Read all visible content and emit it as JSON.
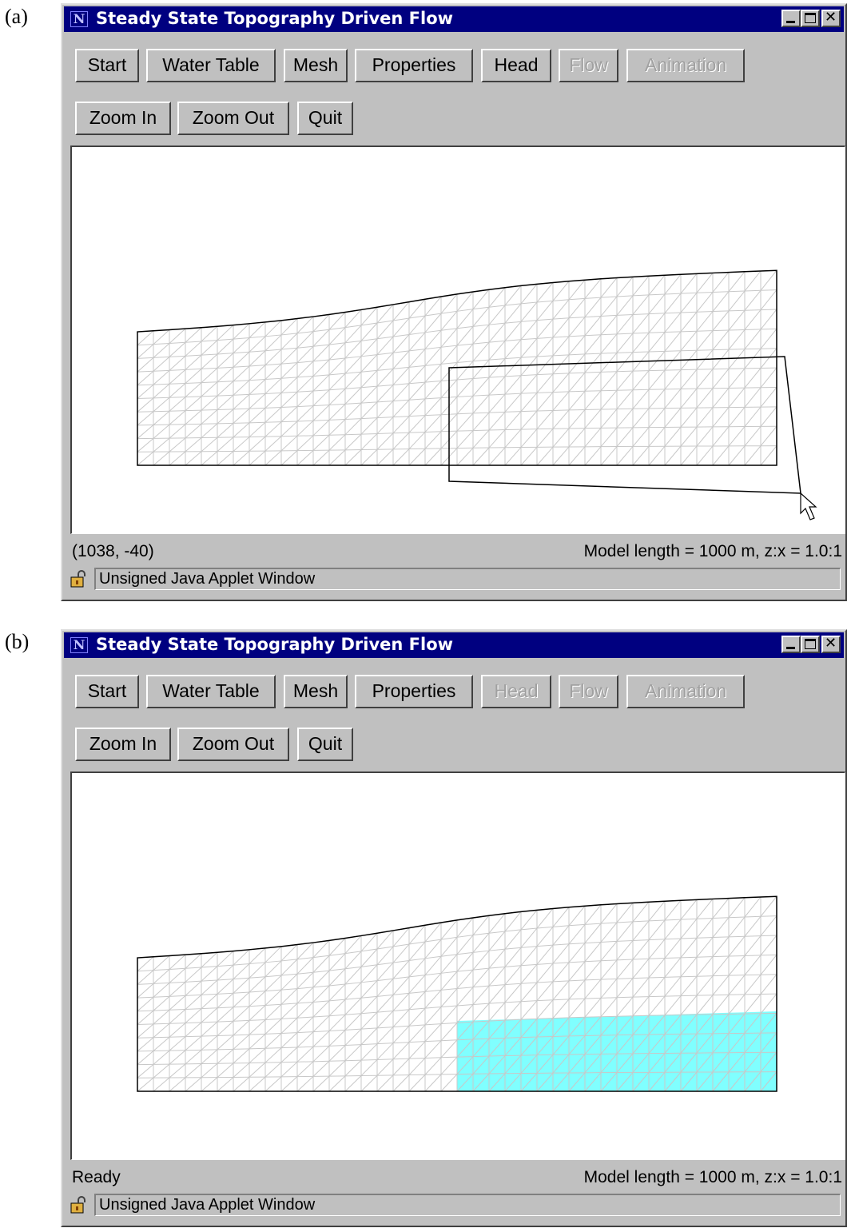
{
  "panels": [
    {
      "letter": "(a)",
      "title": "Steady State Topography Driven Flow",
      "buttons_row1": [
        {
          "label": "Start",
          "enabled": true
        },
        {
          "label": "Water Table",
          "enabled": true
        },
        {
          "label": "Mesh",
          "enabled": true
        },
        {
          "label": "Properties",
          "enabled": true
        },
        {
          "label": "Head",
          "enabled": true
        },
        {
          "label": "Flow",
          "enabled": false
        },
        {
          "label": "Animation",
          "enabled": false
        }
      ],
      "buttons_row2": [
        {
          "label": "Zoom In",
          "enabled": true
        },
        {
          "label": "Zoom Out",
          "enabled": true
        },
        {
          "label": "Quit",
          "enabled": true
        }
      ],
      "status_left": "(1038, -40)",
      "status_right": "Model length = 1000 m, z:x = 1.0:1",
      "applet_label": "Unsigned Java Applet Window",
      "selection_box": true,
      "highlight_region": false,
      "cursor_icon": "arrow-cursor-icon"
    },
    {
      "letter": "(b)",
      "title": "Steady State Topography Driven Flow",
      "buttons_row1": [
        {
          "label": "Start",
          "enabled": true
        },
        {
          "label": "Water Table",
          "enabled": true
        },
        {
          "label": "Mesh",
          "enabled": true
        },
        {
          "label": "Properties",
          "enabled": true
        },
        {
          "label": "Head",
          "enabled": false
        },
        {
          "label": "Flow",
          "enabled": false
        },
        {
          "label": "Animation",
          "enabled": false
        }
      ],
      "buttons_row2": [
        {
          "label": "Zoom In",
          "enabled": true
        },
        {
          "label": "Zoom Out",
          "enabled": true
        },
        {
          "label": "Quit",
          "enabled": true
        }
      ],
      "status_left": "Ready",
      "status_right": "Model length = 1000 m, z:x = 1.0:1",
      "applet_label": "Unsigned Java Applet Window",
      "selection_box": false,
      "highlight_region": true,
      "highlight_color": "#80ffff"
    }
  ],
  "colors": {
    "titlebar": "#000080",
    "window_face": "#c0c0c0",
    "mesh_line": "#c8c8c8",
    "outline": "#000000"
  }
}
